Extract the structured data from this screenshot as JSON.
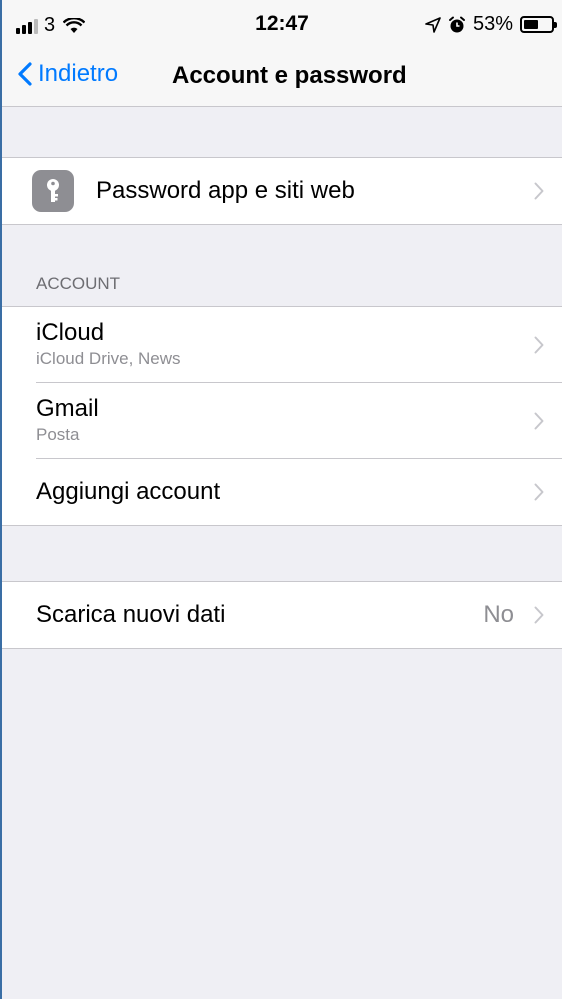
{
  "status_bar": {
    "carrier": "3",
    "time": "12:47",
    "battery_percent": "53%",
    "battery_level": 0.53
  },
  "nav": {
    "back_label": "Indietro",
    "title": "Account e password"
  },
  "passwords_row": {
    "label": "Password app e siti web",
    "icon": "key-icon"
  },
  "accounts_section": {
    "header": "ACCOUNT",
    "items": [
      {
        "title": "iCloud",
        "subtitle": "iCloud Drive, News"
      },
      {
        "title": "Gmail",
        "subtitle": "Posta"
      }
    ],
    "add_label": "Aggiungi account"
  },
  "fetch_row": {
    "label": "Scarica nuovi dati",
    "value": "No"
  },
  "colors": {
    "accent": "#007aff",
    "background": "#efeff4",
    "secondary_text": "#8e8e93"
  }
}
